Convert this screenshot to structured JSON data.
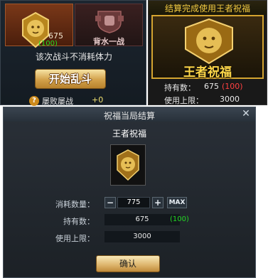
{
  "top_left": {
    "lion_count": "675",
    "lion_sub": "(100)",
    "fight_label": "背水一战",
    "no_stamina_text": "该次战斗不消耗体力",
    "start_button": "开始乱斗",
    "lose_label": "屡败屡战",
    "lose_value": "+0"
  },
  "top_right": {
    "banner": "结算完成使用王者祝福",
    "card_name": "王者祝福",
    "own_label": "持有数：",
    "own_value": "675",
    "own_sub": "(100)",
    "limit_label": "使用上限：",
    "limit_value": "3000"
  },
  "dialog": {
    "title": "祝福当局结算",
    "item_name": "王者祝福",
    "qty_label": "消耗数量：",
    "qty_value": "775",
    "minus": "−",
    "plus": "+",
    "max": "MAX",
    "own_label": "持有数：",
    "own_value": "675",
    "own_sub": "(100)",
    "limit_label": "使用上限：",
    "limit_value": "3000",
    "confirm": "确认",
    "close": "✕"
  },
  "colors": {
    "gold": "#d4a430",
    "green": "#22d822",
    "red": "#ff4040"
  }
}
